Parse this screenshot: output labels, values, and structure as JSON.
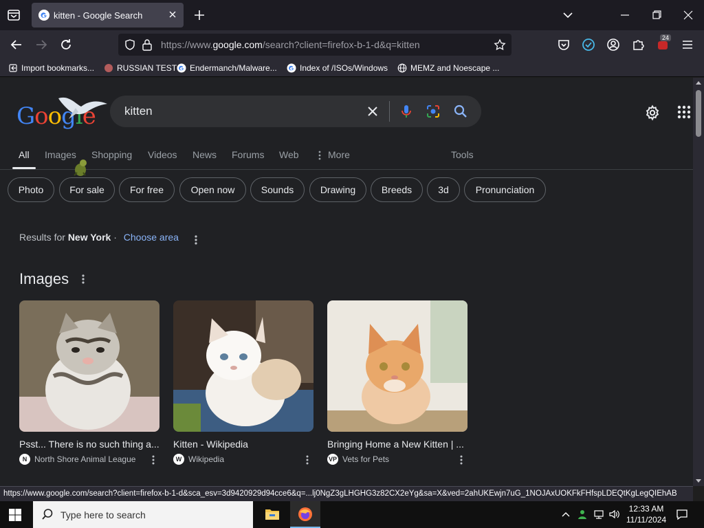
{
  "browser": {
    "tab": {
      "title": "kitten - Google Search"
    },
    "url": {
      "prefix": "https://www.",
      "domain": "google.com",
      "rest": "/search?client=firefox-b-1-d&q=kitten"
    },
    "extension_badge": "24",
    "bookmarks": [
      {
        "label": "Import bookmarks..."
      },
      {
        "label": "RUSSIAN TEST"
      },
      {
        "label": "Endermanch/Malware..."
      },
      {
        "label": "Index of /ISOs/Windows"
      },
      {
        "label": "MEMZ and Noescape ..."
      }
    ],
    "status_url": "https://www.google.com/search?client=firefox-b-1-d&sca_esv=3d9420929d94cce6&q=...lj0NgZ3gLHGHG3z82CX2eYg&sa=X&ved=2ahUKEwjn7uG_1NOJAxUOKFkFHfspLDEQtKgLegQIEhAB"
  },
  "google": {
    "logo_text": "Google",
    "query": "kitten",
    "tabs": [
      {
        "label": "All",
        "active": true
      },
      {
        "label": "Images"
      },
      {
        "label": "Shopping"
      },
      {
        "label": "Videos"
      },
      {
        "label": "News"
      },
      {
        "label": "Forums"
      },
      {
        "label": "Web"
      },
      {
        "label": "More"
      },
      {
        "label": "Tools"
      }
    ],
    "chips": [
      "Photo",
      "For sale",
      "For free",
      "Open now",
      "Sounds",
      "Drawing",
      "Breeds",
      "3d",
      "Pronunciation"
    ],
    "results_for": {
      "prefix": "Results for",
      "location": "New York",
      "separator": "·",
      "link": "Choose area"
    },
    "images_heading": "Images",
    "image_results": [
      {
        "title": "Psst... There is no such thing a...",
        "source": "North Shore Animal League",
        "source_icon_text": "N"
      },
      {
        "title": "Kitten - Wikipedia",
        "source": "Wikipedia",
        "source_icon_text": "W"
      },
      {
        "title": "Bringing Home a New Kitten | ...",
        "source": "Vets for Pets",
        "source_icon_text": "VP"
      }
    ]
  },
  "taskbar": {
    "search_placeholder": "Type here to search",
    "time": "12:33 AM",
    "date": "11/11/2024"
  },
  "colors": {
    "accent_blue": "#8ab4f8",
    "page_bg": "#202124",
    "searchbox_bg": "#303134"
  }
}
